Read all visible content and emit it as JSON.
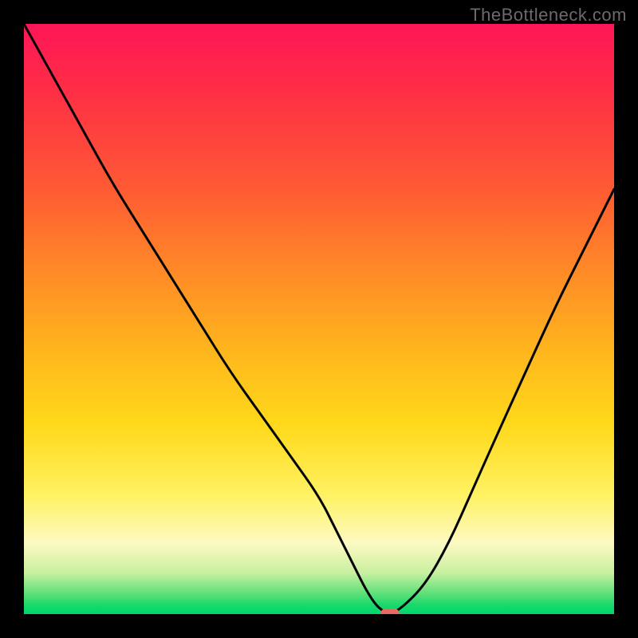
{
  "watermark": "TheBottleneck.com",
  "colors": {
    "frame_bg": "#000000",
    "curve_stroke": "#000000",
    "marker_fill": "#e96a5f",
    "watermark_text": "#6b6b6b",
    "gradient_stops": [
      {
        "stop": 0.0,
        "color": "#ff1658"
      },
      {
        "stop": 0.1,
        "color": "#ff2b47"
      },
      {
        "stop": 0.28,
        "color": "#ff5a34"
      },
      {
        "stop": 0.42,
        "color": "#ff8a27"
      },
      {
        "stop": 0.55,
        "color": "#ffb41d"
      },
      {
        "stop": 0.68,
        "color": "#ffd91a"
      },
      {
        "stop": 0.8,
        "color": "#fff264"
      },
      {
        "stop": 0.88,
        "color": "#fdf9c3"
      },
      {
        "stop": 0.93,
        "color": "#c8f0a0"
      },
      {
        "stop": 0.965,
        "color": "#5fe078"
      },
      {
        "stop": 0.985,
        "color": "#18d86c"
      },
      {
        "stop": 1.0,
        "color": "#00d66a"
      }
    ]
  },
  "chart_data": {
    "type": "line",
    "title": "",
    "xlabel": "",
    "ylabel": "",
    "xlim": [
      0,
      100
    ],
    "ylim": [
      0,
      100
    ],
    "series": [
      {
        "name": "bottleneck-curve",
        "x": [
          0,
          5,
          10,
          15,
          20,
          25,
          30,
          35,
          40,
          45,
          50,
          53,
          56,
          58,
          60,
          62,
          64,
          68,
          72,
          76,
          80,
          85,
          90,
          95,
          100
        ],
        "values": [
          100,
          91,
          82,
          73,
          65,
          57,
          49,
          41,
          34,
          27,
          20,
          14,
          8,
          4,
          1,
          0,
          1,
          5,
          12,
          21,
          30,
          41,
          52,
          62,
          72
        ]
      }
    ],
    "marker": {
      "x": 62,
      "y": 0,
      "name": "optimum-point"
    }
  }
}
